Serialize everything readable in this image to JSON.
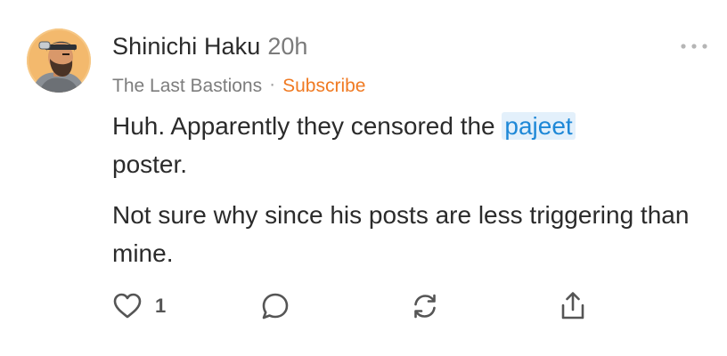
{
  "post": {
    "author": "Shinichi Haku",
    "timestamp": "20h",
    "community": "The Last Bastions",
    "separator": "·",
    "subscribe_label": "Subscribe",
    "body": {
      "line1_before": "Huh. Apparently they censored the ",
      "mention": "pajeet",
      "line1_after": " poster.",
      "paragraph2": "Not sure why since his posts are less triggering than mine."
    },
    "actions": {
      "like_count": "1",
      "like_icon": "heart-icon",
      "comment_icon": "comment-bubble-icon",
      "repost_icon": "repost-icon",
      "share_icon": "share-icon",
      "more_icon": "more-dots-icon"
    }
  },
  "colors": {
    "accent": "#f07a22",
    "mention_text": "#1e88d7",
    "mention_bg": "#e3f0fb"
  }
}
